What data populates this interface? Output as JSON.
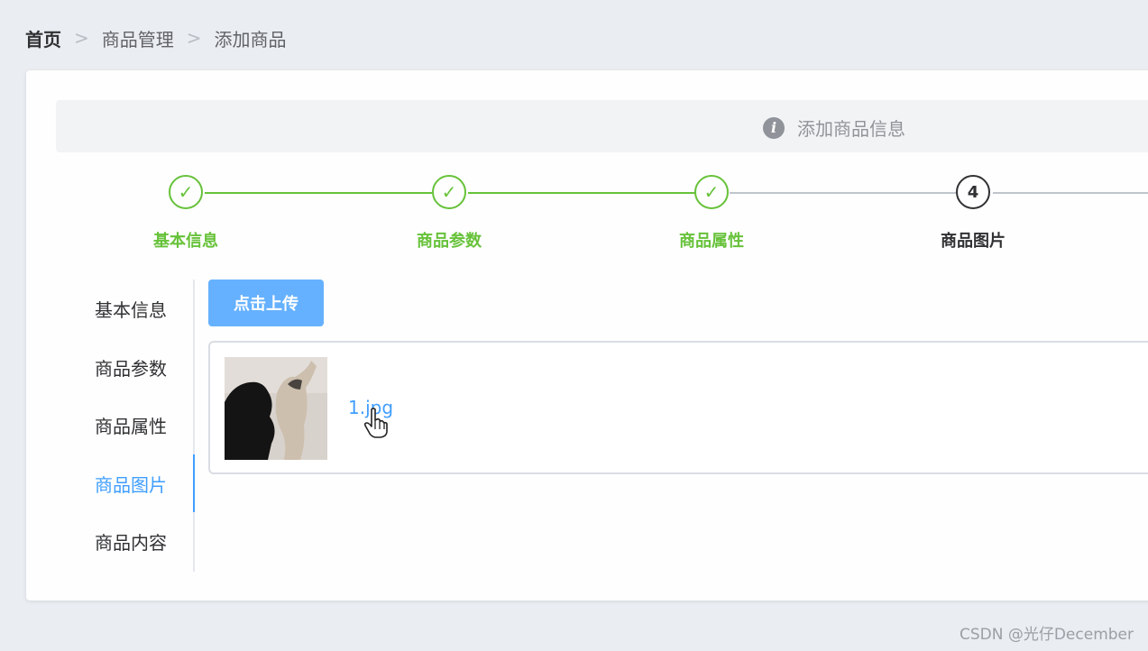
{
  "breadcrumb": {
    "items": [
      "首页",
      "商品管理",
      "添加商品"
    ],
    "separator": ">"
  },
  "alert": {
    "icon": "info-icon",
    "text": "添加商品信息"
  },
  "steps": [
    {
      "title": "基本信息",
      "status": "done",
      "icon": "check-icon"
    },
    {
      "title": "商品参数",
      "status": "done",
      "icon": "check-icon"
    },
    {
      "title": "商品属性",
      "status": "done",
      "icon": "check-icon"
    },
    {
      "title": "商品图片",
      "status": "active",
      "number": "4"
    }
  ],
  "tabs": {
    "items": [
      "基本信息",
      "商品参数",
      "商品属性",
      "商品图片",
      "商品内容"
    ],
    "active_index": 3
  },
  "upload": {
    "button_label": "点击上传",
    "files": [
      {
        "name": "1.jpg",
        "thumbnail": "dog-photo"
      }
    ]
  },
  "watermark": "CSDN @光仔December",
  "colors": {
    "success": "#67c23a",
    "primary": "#409eff",
    "button": "#66b1ff"
  }
}
